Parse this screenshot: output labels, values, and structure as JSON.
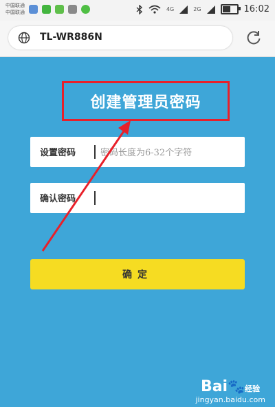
{
  "status_bar": {
    "carrier_1": "中国联通",
    "carrier_2": "中国联通",
    "net_1": "4G",
    "net_2": "2G",
    "time": "16:02",
    "battery_level": 0.55
  },
  "browser": {
    "url": "TL-WR886N"
  },
  "page": {
    "title": "创建管理员密码",
    "set_password_label": "设置密码",
    "set_password_placeholder": "密码长度为6-32个字符",
    "confirm_password_label": "确认密码",
    "confirm_password_placeholder": "",
    "confirm_button": "确定"
  },
  "watermark": {
    "brand": "Bai",
    "brand_suffix": "经验",
    "site": "jingyan.baidu.com"
  },
  "colors": {
    "page_bg": "#3ea6d8",
    "button": "#f6dc22",
    "annotation": "#e8202a"
  }
}
